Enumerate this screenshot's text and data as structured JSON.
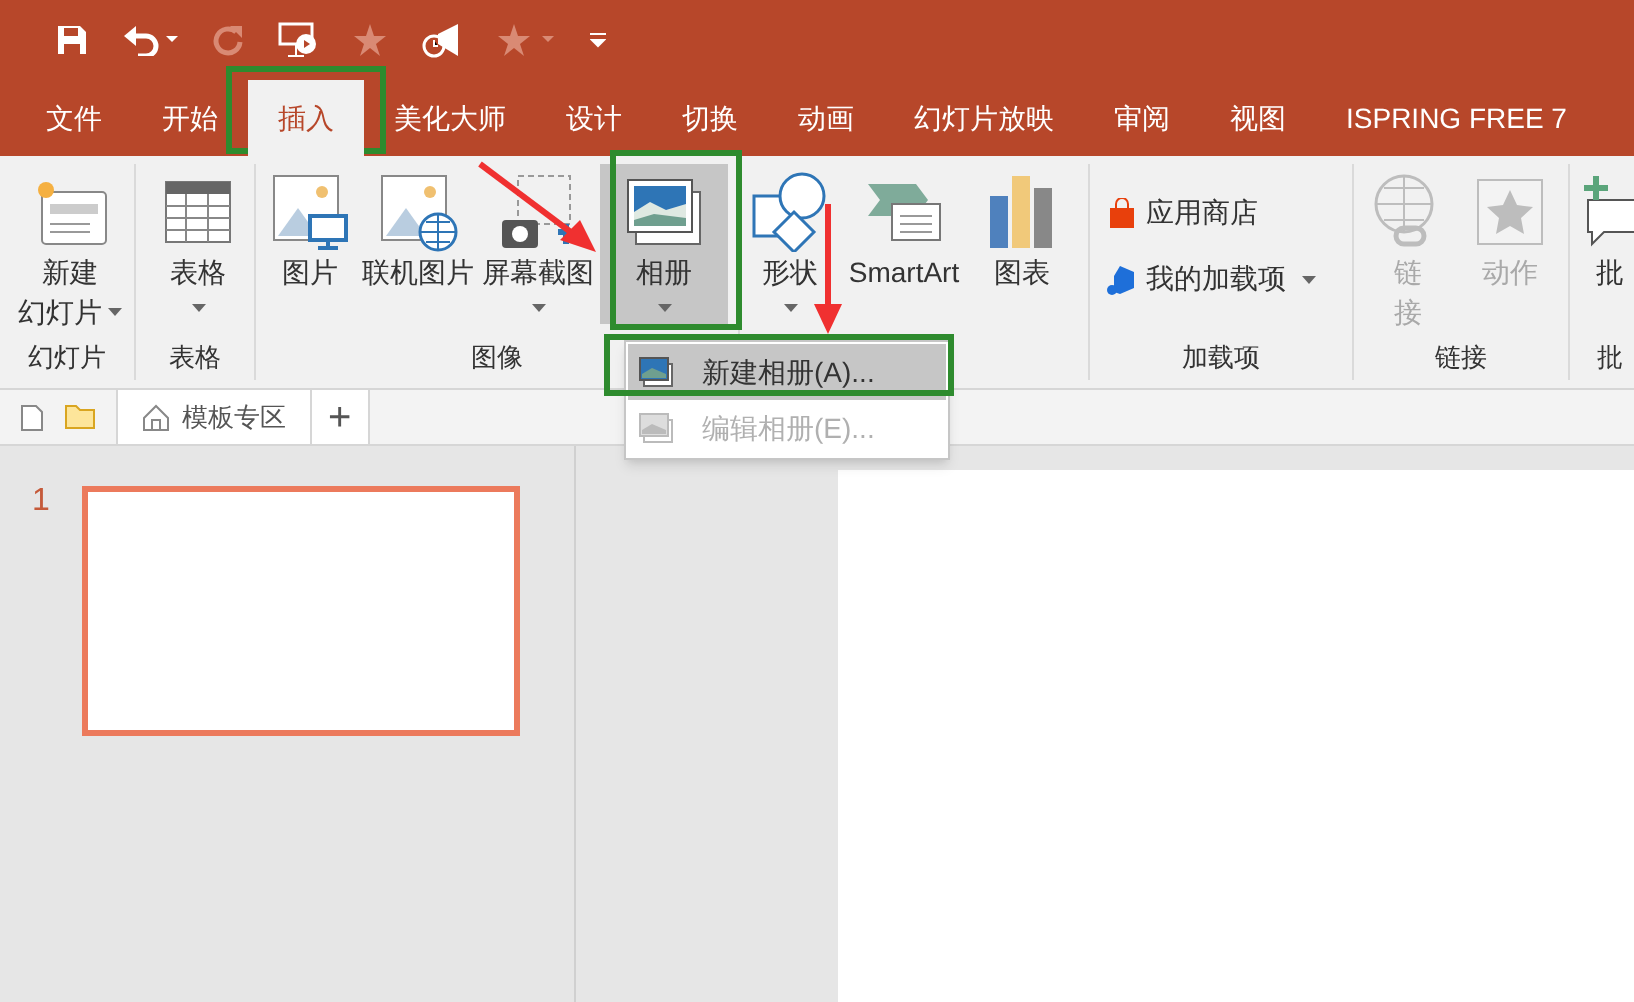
{
  "tabs": [
    {
      "label": "文件",
      "selected": false
    },
    {
      "label": "开始",
      "selected": false
    },
    {
      "label": "插入",
      "selected": true
    },
    {
      "label": "美化大师",
      "selected": false
    },
    {
      "label": "设计",
      "selected": false
    },
    {
      "label": "切换",
      "selected": false
    },
    {
      "label": "动画",
      "selected": false
    },
    {
      "label": "幻灯片放映",
      "selected": false
    },
    {
      "label": "审阅",
      "selected": false
    },
    {
      "label": "视图",
      "selected": false
    },
    {
      "label": "ISPRING FREE 7",
      "selected": false
    }
  ],
  "ribbon": {
    "groups": [
      {
        "label": "幻灯片",
        "buttons": [
          {
            "kind": "large",
            "lines": [
              "新建",
              "幻灯片"
            ],
            "dropdown": true,
            "disabled": false,
            "pressed": false
          }
        ]
      },
      {
        "label": "表格",
        "buttons": [
          {
            "kind": "large",
            "lines": [
              "表格"
            ],
            "dropdown": true,
            "disabled": false,
            "pressed": false
          }
        ]
      },
      {
        "label": "图像",
        "buttons": [
          {
            "kind": "large",
            "lines": [
              "图片"
            ],
            "dropdown": false,
            "disabled": false,
            "pressed": false
          },
          {
            "kind": "large",
            "lines": [
              "联机图片"
            ],
            "dropdown": false,
            "disabled": false,
            "pressed": false
          },
          {
            "kind": "large",
            "lines": [
              "屏幕截图"
            ],
            "dropdown": true,
            "disabled": false,
            "pressed": false
          },
          {
            "kind": "large",
            "lines": [
              "相册"
            ],
            "dropdown": true,
            "disabled": false,
            "pressed": true
          }
        ]
      },
      {
        "buttons": [
          {
            "kind": "large",
            "lines": [
              "形状"
            ],
            "dropdown": true,
            "disabled": false,
            "pressed": false
          },
          {
            "kind": "large",
            "lines": [
              "SmartArt"
            ],
            "dropdown": false,
            "disabled": false,
            "pressed": false
          },
          {
            "kind": "large",
            "lines": [
              "图表"
            ],
            "dropdown": false,
            "disabled": false,
            "pressed": false
          }
        ]
      },
      {
        "label": "加载项",
        "buttons": [
          {
            "kind": "small",
            "lines": [
              "应用商店"
            ],
            "dropdown": false,
            "disabled": false,
            "pressed": false
          },
          {
            "kind": "small",
            "lines": [
              "我的加载项"
            ],
            "dropdown": true,
            "disabled": false,
            "pressed": false
          }
        ]
      },
      {
        "label": "链接",
        "buttons": [
          {
            "kind": "large",
            "lines": [
              "链",
              "接"
            ],
            "dropdown": false,
            "disabled": true,
            "pressed": false
          },
          {
            "kind": "large",
            "lines": [
              "动作"
            ],
            "dropdown": false,
            "disabled": true,
            "pressed": false
          }
        ]
      },
      {
        "label": "批",
        "buttons": [
          {
            "kind": "large",
            "lines": [
              "批"
            ],
            "dropdown": false,
            "disabled": false,
            "pressed": false
          }
        ]
      }
    ]
  },
  "doc_tabs": {
    "tab": "模板专区",
    "add": "+"
  },
  "menu": {
    "items": [
      {
        "label": "新建相册(A)...",
        "disabled": false,
        "selected": true
      },
      {
        "label": "编辑相册(E)...",
        "disabled": true,
        "selected": false
      }
    ]
  },
  "slides": [
    {
      "number": "1",
      "selected": true
    }
  ]
}
